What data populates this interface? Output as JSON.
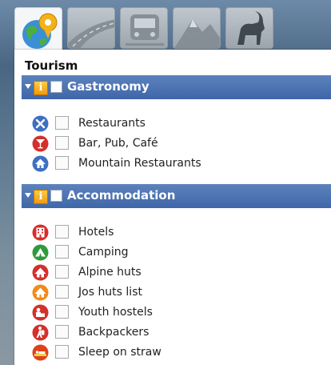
{
  "tabs": [
    {
      "name": "tourism-tab",
      "icon": "globe-pin-icon",
      "active": true
    },
    {
      "name": "roads-tab",
      "icon": "road-icon",
      "active": false
    },
    {
      "name": "transport-tab",
      "icon": "train-icon",
      "active": false
    },
    {
      "name": "mountains-tab",
      "icon": "mountain-icon",
      "active": false
    },
    {
      "name": "wildlife-tab",
      "icon": "ibex-icon",
      "active": false
    }
  ],
  "panel": {
    "title": "Tourism"
  },
  "categories": [
    {
      "label": "Gastronomy",
      "items": [
        {
          "label": "Restaurants",
          "icon": "cutlery-icon",
          "color": "#3d6fc4"
        },
        {
          "label": "Bar, Pub, Café",
          "icon": "cocktail-glass-icon",
          "color": "#d4302c"
        },
        {
          "label": "Mountain Restaurants",
          "icon": "chalet-icon",
          "color": "#3d6fc4"
        }
      ]
    },
    {
      "label": "Accommodation",
      "items": [
        {
          "label": "Hotels",
          "icon": "hotel-icon",
          "color": "#d4302c"
        },
        {
          "label": "Camping",
          "icon": "tent-icon",
          "color": "#2f9a3c"
        },
        {
          "label": "Alpine huts",
          "icon": "alpine-hut-icon",
          "color": "#d4302c"
        },
        {
          "label": "Jos huts list",
          "icon": "hut-list-icon",
          "color": "#f08a1c"
        },
        {
          "label": "Youth hostels",
          "icon": "youth-hostel-icon",
          "color": "#d4302c"
        },
        {
          "label": "Backpackers",
          "icon": "backpacker-icon",
          "color": "#d4302c"
        },
        {
          "label": "Sleep on straw",
          "icon": "straw-bed-icon",
          "color": "#e2401c"
        }
      ]
    }
  ]
}
